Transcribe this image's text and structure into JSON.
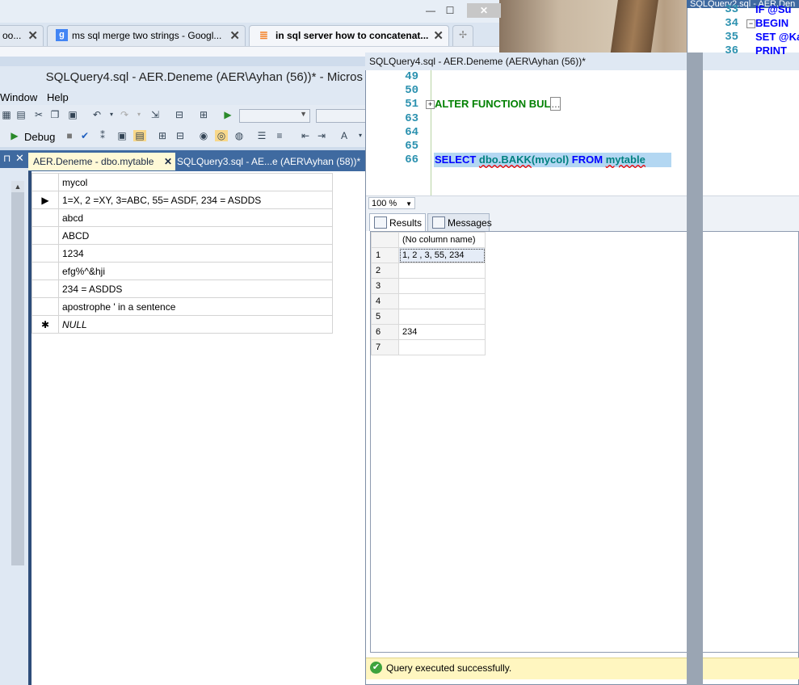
{
  "browser": {
    "tabs": [
      {
        "label": "oo...",
        "active": false
      },
      {
        "label": "ms sql merge two strings - Googl...",
        "active": false
      },
      {
        "label": "in sql server how to concatenat...",
        "active": true
      }
    ],
    "window_controls": {
      "minimize": "—",
      "maximize": "☐",
      "close": "✕"
    }
  },
  "ssms": {
    "title": "SQLQuery4.sql - AER.Deneme (AER\\Ayhan (56))* - Micros",
    "menu": [
      "Window",
      "Help"
    ],
    "debug_label": "Debug",
    "doc_tabs": [
      {
        "label": "AER.Deneme - dbo.mytable",
        "active": true
      },
      {
        "label": "SQLQuery3.sql - AE...e (AER\\Ayhan (58))*",
        "active": false
      }
    ],
    "table": {
      "column": "mycol",
      "rows": [
        {
          "marker": "▶",
          "value": "1=X, 2 =XY, 3=ABC, 55= ASDF, 234 = ASDDS"
        },
        {
          "marker": "",
          "value": "abcd"
        },
        {
          "marker": "",
          "value": "ABCD"
        },
        {
          "marker": "",
          "value": "1234"
        },
        {
          "marker": "",
          "value": "efg%^&hji"
        },
        {
          "marker": "",
          "value": "234 = ASDDS"
        },
        {
          "marker": "",
          "value": "apostrophe ' in a sentence"
        },
        {
          "marker": "✱",
          "value": "NULL"
        }
      ]
    }
  },
  "query": {
    "title": "SQLQuery4.sql - AER.Deneme (AER\\Ayhan (56))*",
    "line_numbers": [
      "49",
      "50",
      "51",
      "63",
      "64",
      "65",
      "66"
    ],
    "collapsed_line": {
      "text": "ALTER FUNCTION BUL",
      "ellipsis": "..."
    },
    "select_line": {
      "kw1": "SELECT",
      "fn": "dbo.BAKK",
      "arg": "(mycol)",
      "kw2": "FROM",
      "obj": "mytable"
    },
    "zoom": "100 %",
    "result_tabs": [
      "Results",
      "Messages"
    ],
    "results": {
      "column": "(No column name)",
      "rows": [
        {
          "n": "1",
          "v": "1, 2 , 3, 55, 234"
        },
        {
          "n": "2",
          "v": ""
        },
        {
          "n": "3",
          "v": ""
        },
        {
          "n": "4",
          "v": ""
        },
        {
          "n": "5",
          "v": ""
        },
        {
          "n": "6",
          "v": "234"
        },
        {
          "n": "7",
          "v": ""
        }
      ]
    },
    "status": "Query executed successfully."
  },
  "query2": {
    "title": "SQLQuery2.sql - AER.Den",
    "lines": [
      {
        "n": "33",
        "code": "IF @Su"
      },
      {
        "n": "34",
        "code": "BEGIN"
      },
      {
        "n": "35",
        "code": "SET @Ka"
      },
      {
        "n": "36",
        "code": "PRINT"
      }
    ]
  }
}
